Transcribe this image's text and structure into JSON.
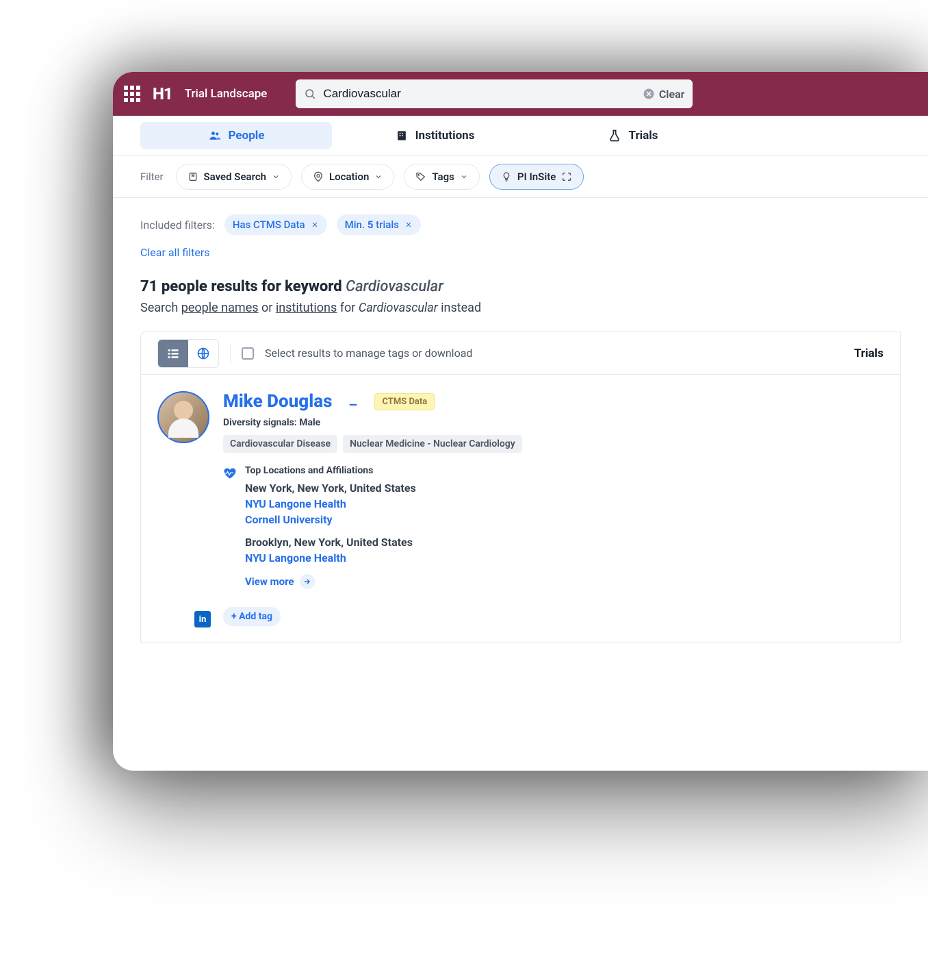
{
  "header": {
    "app_title": "Trial Landscape",
    "logo_text": "H1",
    "search_value": "Cardiovascular",
    "clear_label": "Clear"
  },
  "tabs": {
    "people": "People",
    "institutions": "Institutions",
    "trials": "Trials"
  },
  "filters": {
    "label": "Filter",
    "saved_search": "Saved Search",
    "location": "Location",
    "tags": "Tags",
    "pi_insite": "PI InSite"
  },
  "included": {
    "label": "Included filters:",
    "chips": [
      {
        "text": "Has CTMS Data"
      },
      {
        "prefix": "Min.",
        "bold": "5",
        "suffix": "trials"
      }
    ],
    "clear_all": "Clear all filters"
  },
  "results": {
    "count": "71",
    "heading_mid": "people results for keyword",
    "keyword": "Cardiovascular",
    "suggest_prefix": "Search",
    "suggest_people": "people names",
    "suggest_or": "or",
    "suggest_institutions": "institutions",
    "suggest_for": "for",
    "suggest_keyword": "Cardiovascular",
    "suggest_suffix": "instead"
  },
  "panel": {
    "hint": "Select results to manage tags or download",
    "column_head": "Trials"
  },
  "card": {
    "name": "Mike Douglas",
    "ctms_badge": "CTMS Data",
    "diversity": "Diversity signals: Male",
    "tags": [
      "Cardiovascular Disease",
      "Nuclear Medicine - Nuclear Cardiology"
    ],
    "loc_title": "Top Locations and Affiliations",
    "blocks": [
      {
        "location": "New York, New York, United States",
        "affils": [
          "NYU Langone Health",
          "Cornell University"
        ]
      },
      {
        "location": "Brooklyn, New York, United States",
        "affils": [
          "NYU Langone Health"
        ]
      }
    ],
    "view_more": "View more",
    "add_tag": "+ Add tag",
    "linkedin": "in"
  }
}
